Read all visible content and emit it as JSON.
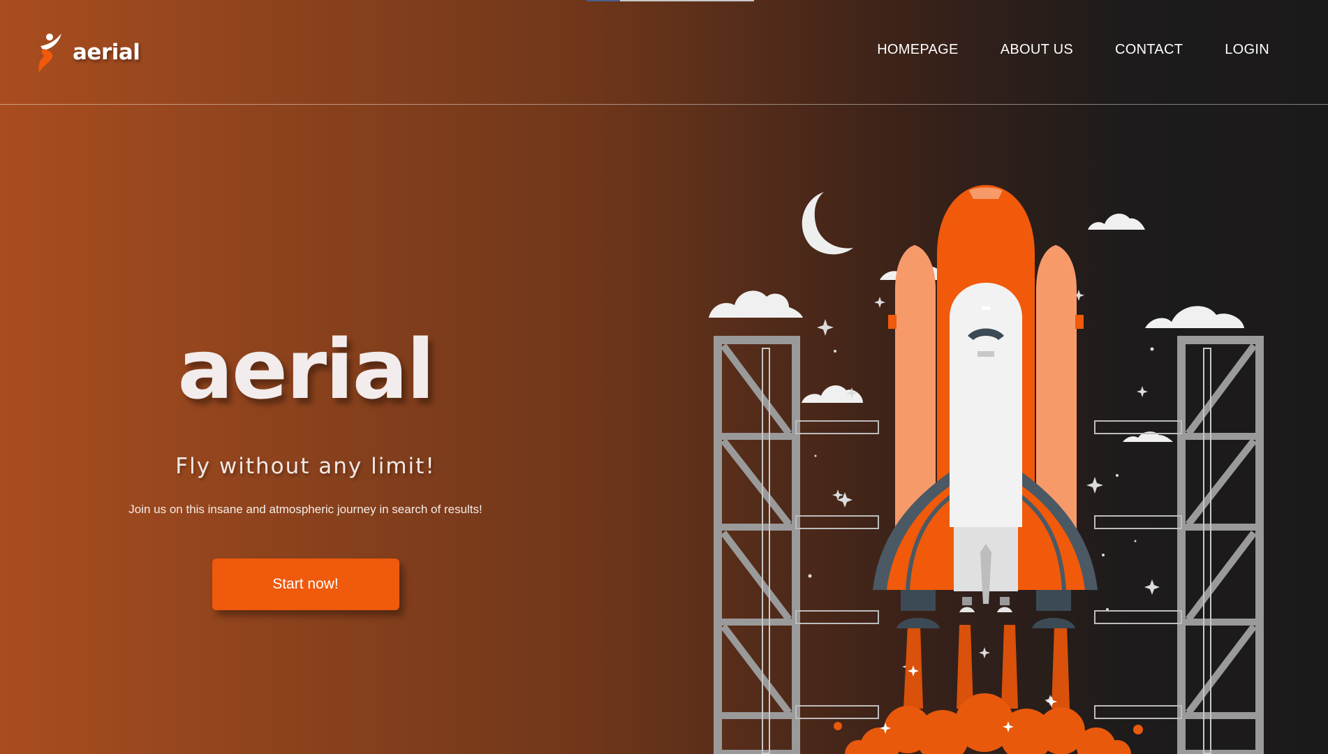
{
  "brand": {
    "name": "aerial",
    "accent": "#ef5a0c"
  },
  "nav": {
    "items": [
      {
        "label": "HOMEPAGE"
      },
      {
        "label": "ABOUT US"
      },
      {
        "label": "CONTACT"
      },
      {
        "label": "LOGIN"
      }
    ]
  },
  "hero": {
    "title": "aerial",
    "subtitle": "Fly without any limit!",
    "description": "Join us on this insane and atmospheric journey in search of results!",
    "cta_label": "Start now!"
  },
  "illustration": {
    "subject": "rocket-launch",
    "icons": [
      "moon-icon",
      "cloud-icon",
      "star-icon",
      "launch-tower-icon",
      "space-shuttle-icon",
      "exhaust-smoke-icon"
    ]
  },
  "colors": {
    "background_start": "#a94d1f",
    "background_end": "#1b1a1a",
    "shuttle_orange": "#f05a0a",
    "booster_peach": "#f79a6a",
    "tower_gray": "#9a9a9a"
  }
}
